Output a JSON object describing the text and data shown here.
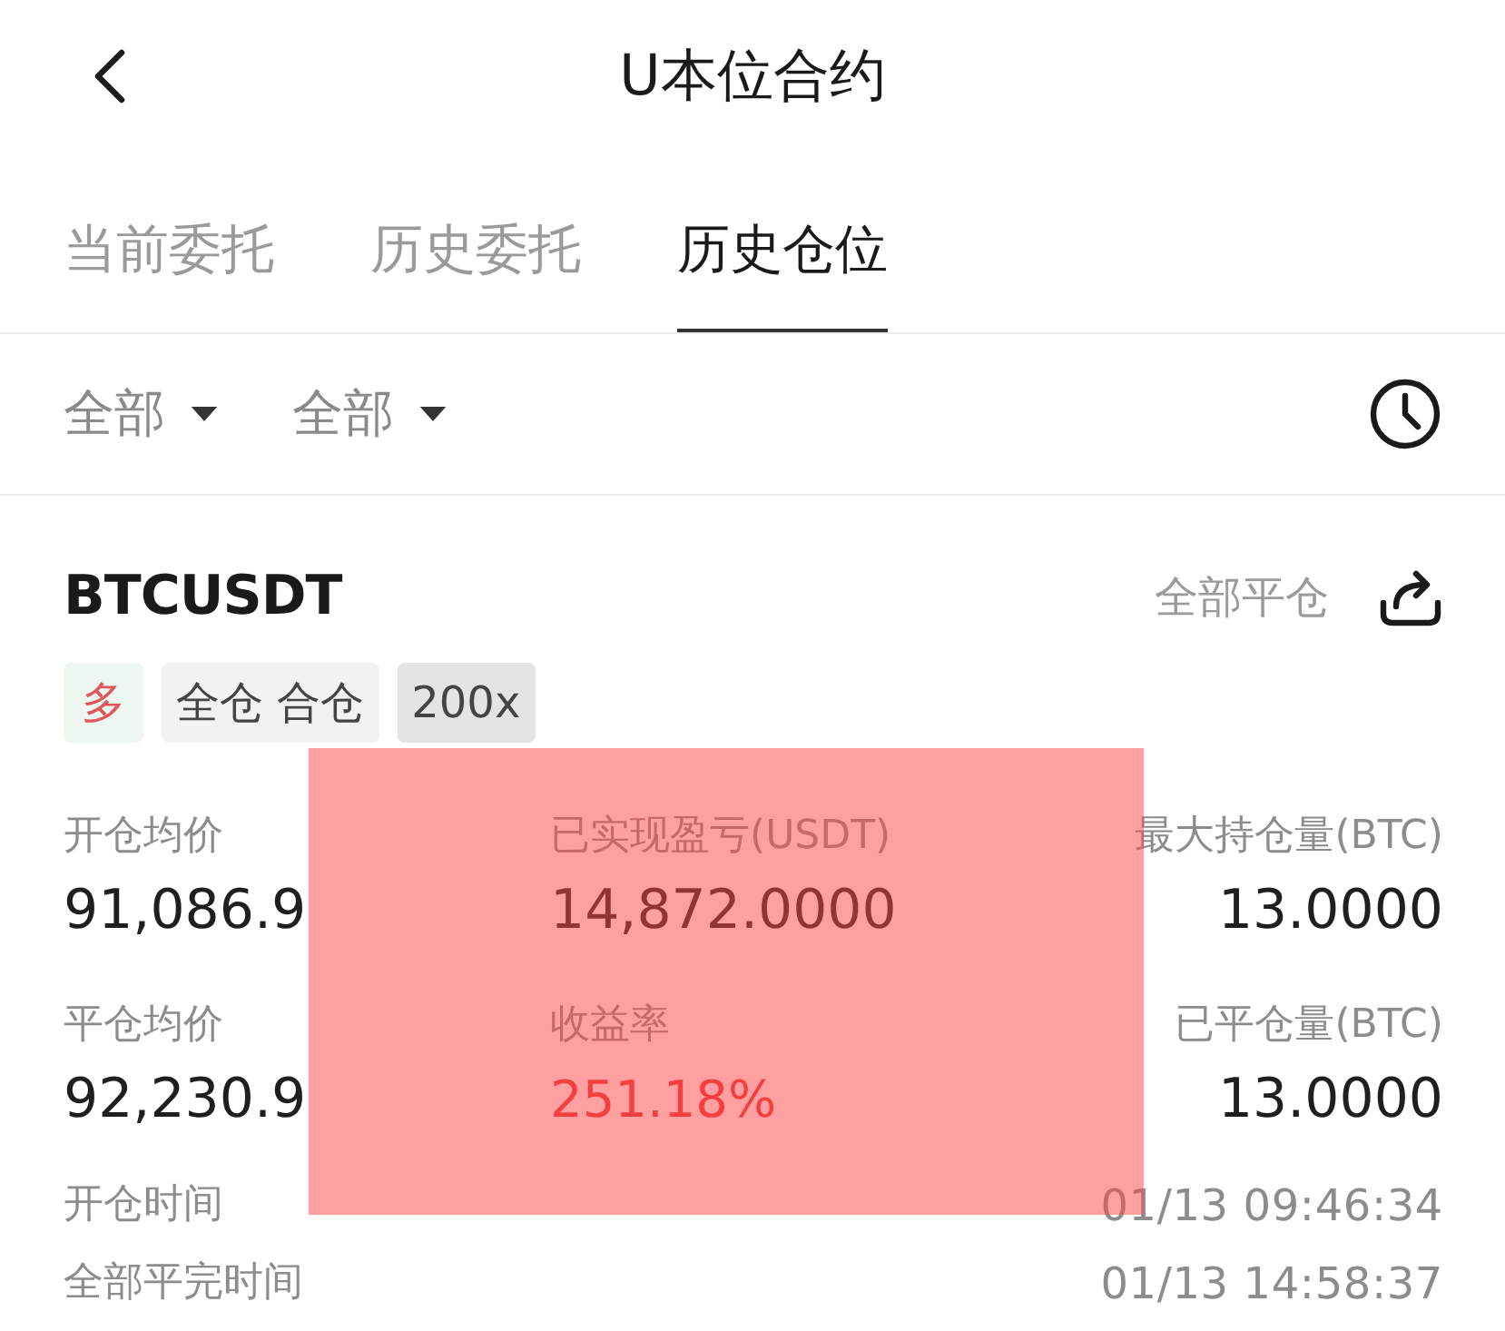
{
  "header": {
    "title": "U本位合约"
  },
  "tabs": [
    {
      "label": "当前委托",
      "selected": false
    },
    {
      "label": "历史委托",
      "selected": false
    },
    {
      "label": "历史仓位",
      "selected": true
    }
  ],
  "filters": [
    {
      "label": "全部"
    },
    {
      "label": "全部"
    }
  ],
  "position": {
    "symbol": "BTCUSDT",
    "action": "全部平仓",
    "tags": [
      {
        "label": "多",
        "kind": "side"
      },
      {
        "label": "全仓 合仓",
        "kind": "mode"
      },
      {
        "label": "200x",
        "kind": "leverage"
      }
    ],
    "stats": [
      {
        "label": "开仓均价",
        "value": "91,086.9",
        "kind": "plain"
      },
      {
        "label": "已实现盈亏(USDT)",
        "value": "14,872.0000",
        "kind": "plain"
      },
      {
        "label": "最大持仓量(BTC)",
        "value": "13.0000",
        "kind": "plain"
      },
      {
        "label": "平仓均价",
        "value": "92,230.9",
        "kind": "plain"
      },
      {
        "label": "收益率",
        "value": "251.18%",
        "kind": "gain"
      },
      {
        "label": "已平仓量(BTC)",
        "value": "13.0000",
        "kind": "plain"
      }
    ],
    "times": [
      {
        "label": "开仓时间",
        "value": "01/13 09:46:34"
      },
      {
        "label": "全部平完时间",
        "value": "01/13 14:58:37"
      }
    ]
  }
}
